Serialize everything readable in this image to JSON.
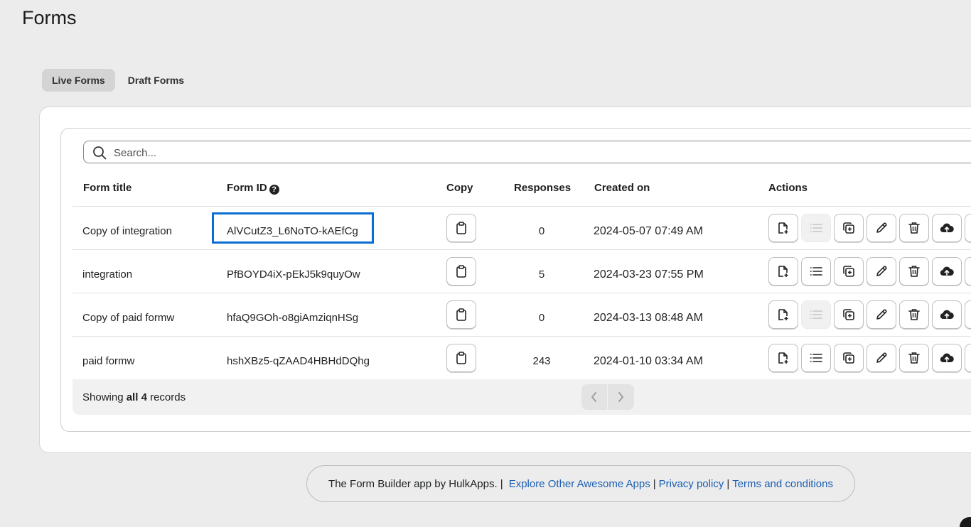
{
  "page": {
    "title": "Forms"
  },
  "tabs": [
    {
      "label": "Live Forms",
      "active": true
    },
    {
      "label": "Draft Forms",
      "active": false
    }
  ],
  "search": {
    "placeholder": "Search..."
  },
  "table": {
    "headers": {
      "title": "Form title",
      "form_id": "Form ID",
      "copy": "Copy",
      "responses": "Responses",
      "created": "Created on",
      "actions": "Actions"
    },
    "rows": [
      {
        "title": "Copy of integration",
        "form_id": "AlVCutZ3_L6NoTO-kAEfCg",
        "responses": "0",
        "created": "2024-05-07 07:49 AM",
        "list_disabled": true
      },
      {
        "title": "integration",
        "form_id": "PfBOYD4iX-pEkJ5k9quyOw",
        "responses": "5",
        "created": "2024-03-23 07:55 PM",
        "list_disabled": false
      },
      {
        "title": "Copy of paid formw",
        "form_id": "hfaQ9GOh-o8giAmziqnHSg",
        "responses": "0",
        "created": "2024-03-13 08:48 AM",
        "list_disabled": true
      },
      {
        "title": "paid formw",
        "form_id": "hshXBz5-qZAAD4HBHdDQhg",
        "responses": "243",
        "created": "2024-01-10 03:34 AM",
        "list_disabled": false
      }
    ],
    "highlighted_row": 0
  },
  "pagination": {
    "prefix": "Showing ",
    "bold": "all 4",
    "suffix": " records"
  },
  "footer": {
    "text": "The Form Builder app by HulkApps. |",
    "sep": "|",
    "links": [
      "Explore Other Awesome Apps",
      "Privacy policy",
      "Terms and conditions"
    ]
  },
  "colors": {
    "highlight": "#0a6ed1",
    "link": "#1a5fb4",
    "background": "#ececec"
  },
  "icons": [
    "search-icon",
    "help-icon",
    "clipboard-icon",
    "file-plus-icon",
    "list-icon",
    "duplicate-icon",
    "pencil-icon",
    "trash-icon",
    "cloud-upload-icon",
    "chevron-left-icon",
    "chevron-right-icon"
  ]
}
